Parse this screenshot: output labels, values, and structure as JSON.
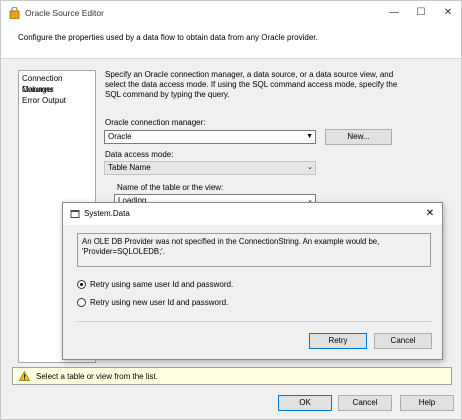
{
  "window": {
    "title": "Oracle Source Editor",
    "minimize": "—",
    "maximize": "☐",
    "close": "✕"
  },
  "header": {
    "text": "Configure the properties used by a data flow to obtain data from any Oracle provider."
  },
  "sidebar": {
    "items": [
      {
        "label": "Connection Manager",
        "selected": true
      },
      {
        "label": "Columns",
        "selected": false
      },
      {
        "label": "Error Output",
        "selected": false
      }
    ]
  },
  "main": {
    "description": "Specify an Oracle connection manager, a data source, or a data source view, and select the data access mode. If using the SQL command access mode, specify the SQL command by typing the query.",
    "connection_label": "Oracle connection manager:",
    "connection_value": "Oracle",
    "new_button": "New...",
    "access_mode_label": "Data access mode:",
    "access_mode_value": "Table Name",
    "table_label": "Name of the table or the view:",
    "table_value": "Loading...",
    "dropdown_arrow": "▼",
    "dropdown_chevron": "⌄"
  },
  "status": {
    "text": "Select a table or view from the list.",
    "icon": "warning-icon"
  },
  "footer": {
    "ok": "OK",
    "cancel": "Cancel",
    "help": "Help"
  },
  "dialog": {
    "title": "System.Data",
    "close": "✕",
    "message": "An OLE DB Provider was not specified in the ConnectionString.  An example would be, 'Provider=SQLOLEDB;'.",
    "option1": "Retry using same user Id and password.",
    "option2": "Retry using new user Id and password.",
    "selected_option": 1,
    "retry": "Retry",
    "cancel": "Cancel"
  },
  "colors": {
    "status_background": "#ffffe1",
    "default_button_border": "#0078d7",
    "window_background": "#f0f0f0"
  }
}
